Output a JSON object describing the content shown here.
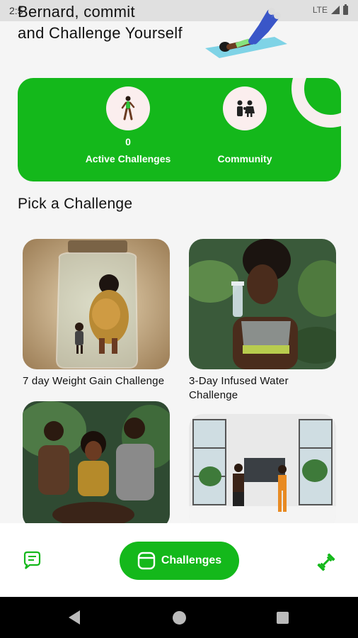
{
  "status_bar": {
    "time": "2:5",
    "network": "LTE"
  },
  "greeting": {
    "line1": "Bernard, commit",
    "line2": "and Challenge Yourself"
  },
  "stats": {
    "active_challenges_value": "0",
    "active_challenges_label": "Active Challenges",
    "community_label": "Community",
    "accent": "#14b81b"
  },
  "section": {
    "title": "Pick a Challenge"
  },
  "challenges": [
    {
      "title": "7 day Weight Gain Challenge"
    },
    {
      "title": "3-Day Infused Water Challenge"
    },
    {
      "title": ""
    },
    {
      "title": ""
    }
  ],
  "bottom_nav": {
    "active_label": "Challenges",
    "chat_icon": "chat-icon",
    "workout_icon": "dumbbell-icon"
  }
}
